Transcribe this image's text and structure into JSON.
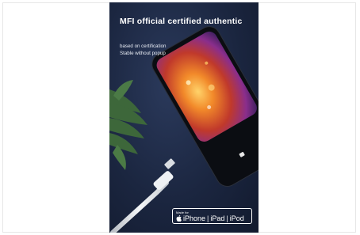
{
  "poster": {
    "headline": "MFI official certified authentic",
    "sub_line1": "based on certification",
    "sub_line2": "Stable without popup"
  },
  "badge": {
    "made_for": "Made for",
    "iphone": "iPhone",
    "ipad": "iPad",
    "ipod": "iPod",
    "separator": "|"
  },
  "colors": {
    "poster_background": "#1b2640",
    "text": "#ffffff",
    "screen_orange": "#f28a2a",
    "screen_purple": "#8a2e8c",
    "cable": "#e9ecef",
    "plant": "#3f6b3a"
  },
  "icons": [
    "apple-logo-icon"
  ]
}
